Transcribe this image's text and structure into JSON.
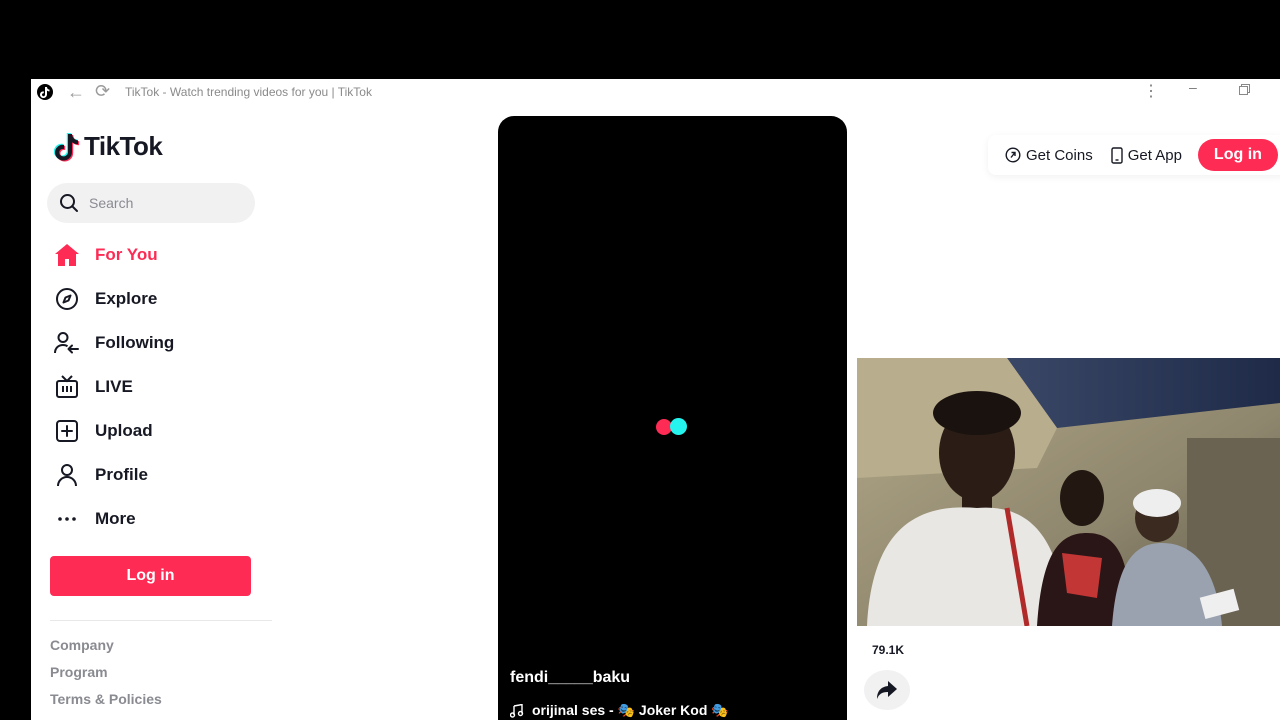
{
  "window": {
    "title": "TikTok - Watch trending videos for you | TikTok"
  },
  "brand": {
    "name": "TikTok",
    "accent": "#fe2c55",
    "cyan": "#25f4ee"
  },
  "search": {
    "placeholder": "Search"
  },
  "nav": {
    "items": [
      {
        "label": "For You",
        "icon": "home-icon",
        "active": true
      },
      {
        "label": "Explore",
        "icon": "compass-icon"
      },
      {
        "label": "Following",
        "icon": "following-icon"
      },
      {
        "label": "LIVE",
        "icon": "live-tv-icon"
      },
      {
        "label": "Upload",
        "icon": "upload-icon"
      },
      {
        "label": "Profile",
        "icon": "profile-icon"
      },
      {
        "label": "More",
        "icon": "more-dots-icon"
      }
    ]
  },
  "sidebar": {
    "login_label": "Log in",
    "footer_links": [
      "Company",
      "Program",
      "Terms & Policies"
    ]
  },
  "header": {
    "get_coins": "Get Coins",
    "get_app": "Get App",
    "login_label": "Log in"
  },
  "video": {
    "username": "fendi_____baku",
    "music": "orijinal ses - 🎭 Joker Kod 🎭"
  },
  "actions": {
    "count": "79.1K"
  }
}
